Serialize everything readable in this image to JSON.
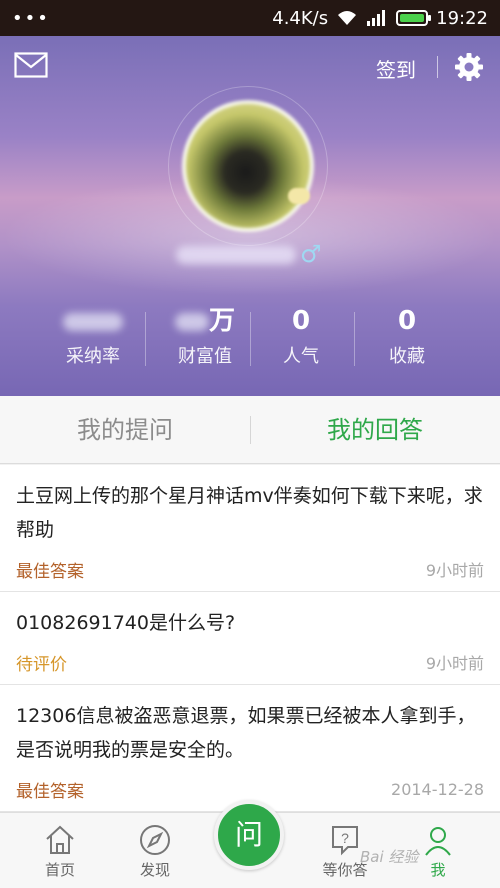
{
  "status_bar": {
    "speed": "4.4K/s",
    "time": "19:22",
    "dots": "•••"
  },
  "header": {
    "checkin_label": "签到",
    "gender_symbol": "♂"
  },
  "stats": [
    {
      "value": "",
      "label": "采纳率"
    },
    {
      "value": "万",
      "label": "财富值"
    },
    {
      "value": "0",
      "label": "人气"
    },
    {
      "value": "0",
      "label": "收藏"
    }
  ],
  "tabs": [
    {
      "label": "我的提问",
      "active": false
    },
    {
      "label": "我的回答",
      "active": true
    }
  ],
  "answers": [
    {
      "question": "土豆网上传的那个星月神话mv伴奏如何下载下来呢，求帮助",
      "status": "最佳答案",
      "time": "9小时前"
    },
    {
      "question": "01082691740是什么号?",
      "status": "待评价",
      "time": "9小时前"
    },
    {
      "question": "12306信息被盗恶意退票，如果票已经被本人拿到手，是否说明我的票是安全的。",
      "status": "最佳答案",
      "time": "2014-12-28"
    }
  ],
  "bottom_nav": {
    "home": "首页",
    "discover": "发现",
    "ask": "问",
    "wait": "等你答",
    "me": "我"
  },
  "watermark": "Bai 经验",
  "colors": {
    "accent": "#2fa84a",
    "best_answer": "#b3622b",
    "pending": "#d6962a"
  }
}
